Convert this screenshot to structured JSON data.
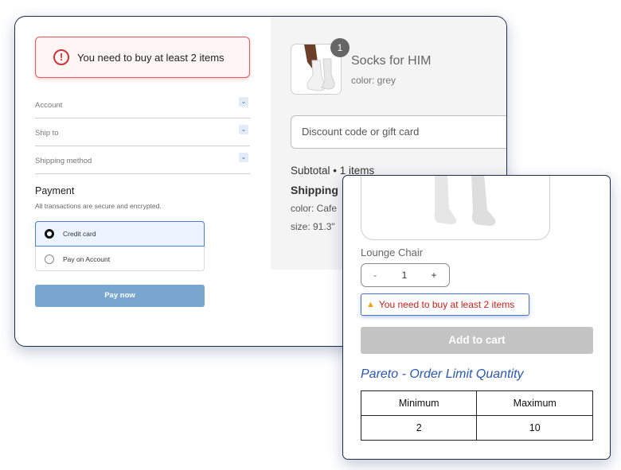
{
  "checkout": {
    "error_banner": {
      "icon": "alert-circle-icon",
      "text": "You need to buy at least 2 items",
      "color": "#d0323a"
    },
    "accordion": [
      {
        "label": "Account",
        "icon": "chevron-down-icon"
      },
      {
        "label": "Ship to",
        "icon": "chevron-down-icon"
      },
      {
        "label": "Shipping method",
        "icon": "chevron-down-icon"
      }
    ],
    "payment": {
      "title": "Payment",
      "subtitle": "All transactions are secure and encrypted.",
      "options": [
        {
          "label": "Credit card",
          "selected": true
        },
        {
          "label": "Pay on Account",
          "selected": false
        }
      ],
      "pay_button": "Pay now",
      "pay_button_color": "#79a6cf"
    },
    "summary": {
      "quantity_badge": "1",
      "product_name": "Socks for HIM",
      "product_variant": "color: grey",
      "discount_placeholder": "Discount code or gift card",
      "subtotal": "Subtotal • 1 items",
      "shipping": "Shipping",
      "option_color": "color: Cafe",
      "option_size": "size: 91.3\""
    }
  },
  "product_card": {
    "title": "Lounge Chair",
    "quantity": {
      "minus": "-",
      "value": "1",
      "plus": "+"
    },
    "warning": {
      "icon": "warning-triangle-icon",
      "text": "You need to buy at least 2 items",
      "color": "#d0201c"
    },
    "add_to_cart": "Add to cart",
    "rule_title": "Pareto - Order Limit Quantity",
    "rule_title_color": "#2a56b5",
    "table": {
      "headers": [
        "Minimum",
        "Maximum"
      ],
      "rows": [
        [
          "2",
          "10"
        ]
      ]
    }
  }
}
